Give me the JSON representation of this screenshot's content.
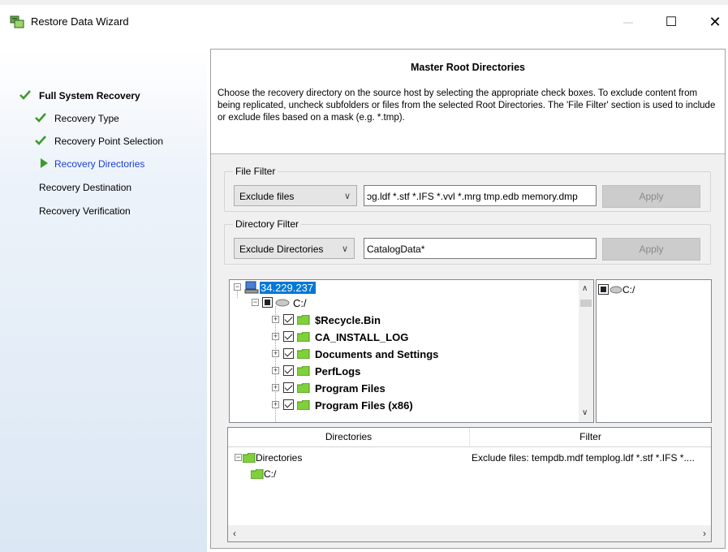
{
  "window": {
    "title": "Restore Data Wizard",
    "controls": {
      "minimize": "—",
      "maximize": "☐",
      "close": "✕"
    }
  },
  "steps": [
    {
      "label": "Full System Recovery",
      "state": "done",
      "level": "top"
    },
    {
      "label": "Recovery Type",
      "state": "done",
      "level": "sub"
    },
    {
      "label": "Recovery Point Selection",
      "state": "done",
      "level": "sub"
    },
    {
      "label": "Recovery Directories",
      "state": "current",
      "level": "sub"
    },
    {
      "label": "Recovery Destination",
      "state": "pending",
      "level": "top"
    },
    {
      "label": "Recovery Verification",
      "state": "pending",
      "level": "top"
    }
  ],
  "header": {
    "title": "Master Root Directories",
    "description": "Choose the recovery directory on the source host by selecting the appropriate check boxes. To exclude content from being replicated, uncheck subfolders or files from the selected Root Directories. The 'File Filter' section is used to include or exclude files based on a mask (e.g. *.tmp)."
  },
  "file_filter": {
    "label": "File Filter",
    "mode": "Exclude files",
    "value": "ɔg.ldf *.stf *.IFS *.vvl *.mrg tmp.edb memory.dmp",
    "apply": "Apply"
  },
  "directory_filter": {
    "label": "Directory Filter",
    "mode": "Exclude Directories",
    "value": "CatalogData*",
    "apply": "Apply"
  },
  "tree": {
    "host": "34.229.237",
    "drive": "C:/",
    "folders": [
      "$Recycle.Bin",
      "CA_INSTALL_LOG",
      "Documents and Settings",
      "PerfLogs",
      "Program Files",
      "Program Files (x86)"
    ]
  },
  "selected_pane": {
    "drive": "C:/"
  },
  "directories_grid": {
    "headers": [
      "Directories",
      "Filter"
    ],
    "root": "Directories",
    "child": "C:/",
    "filter_text": "Exclude files: tempdb.mdf templog.ldf *.stf *.IFS *...."
  }
}
